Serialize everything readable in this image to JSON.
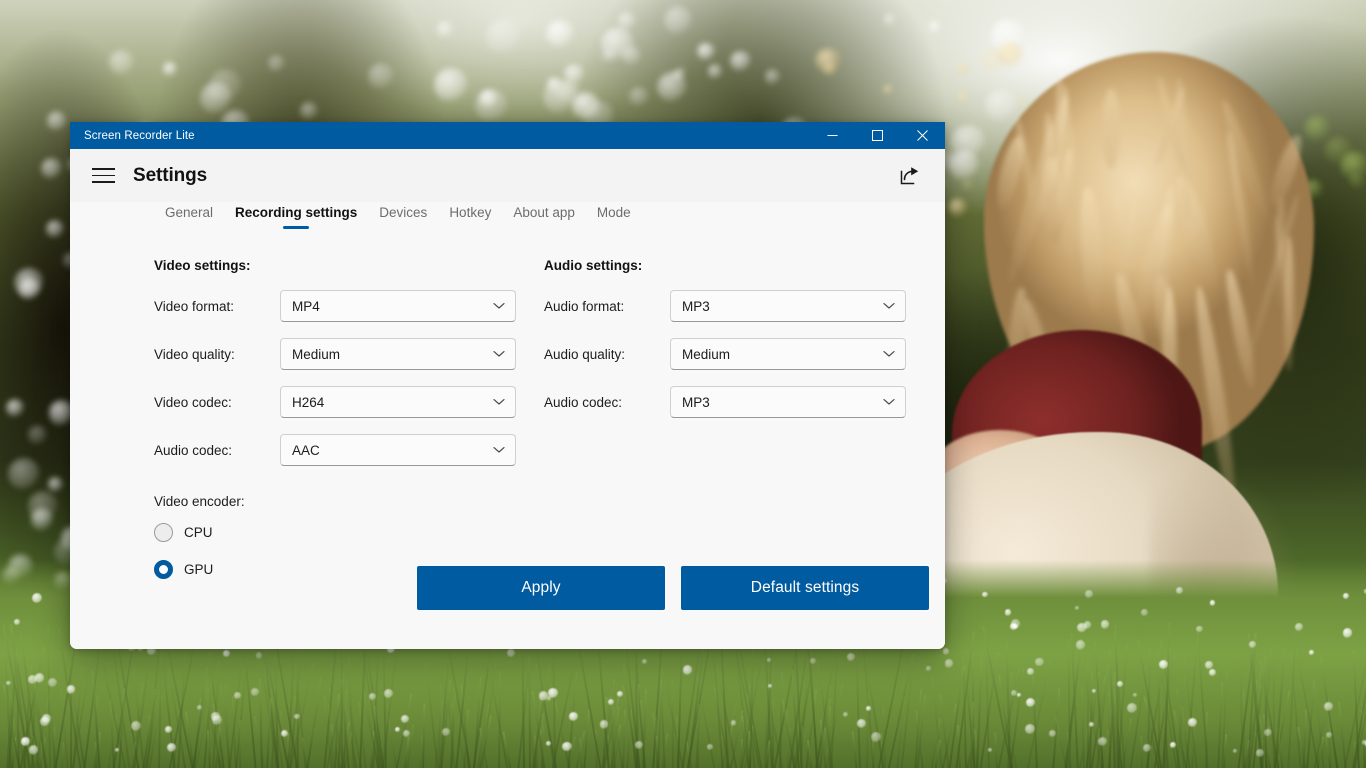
{
  "window": {
    "title": "Screen Recorder Lite",
    "controls": {
      "minimize": "minimize-button",
      "maximize": "maximize-button",
      "close": "close-button"
    }
  },
  "header": {
    "menu_icon": "hamburger-menu-icon",
    "page_title": "Settings",
    "share_icon": "share-icon"
  },
  "tabs": [
    {
      "label": "General",
      "active": false
    },
    {
      "label": "Recording settings",
      "active": true
    },
    {
      "label": "Devices",
      "active": false
    },
    {
      "label": "Hotkey",
      "active": false
    },
    {
      "label": "About app",
      "active": false
    },
    {
      "label": "Mode",
      "active": false
    }
  ],
  "video_settings": {
    "title": "Video settings:",
    "fields": [
      {
        "label": "Video format:",
        "value": "MP4"
      },
      {
        "label": "Video quality:",
        "value": "Medium"
      },
      {
        "label": "Video codec:",
        "value": "H264"
      },
      {
        "label": "Audio codec:",
        "value": "AAC"
      }
    ]
  },
  "audio_settings": {
    "title": "Audio settings:",
    "fields": [
      {
        "label": "Audio format:",
        "value": "MP3"
      },
      {
        "label": "Audio quality:",
        "value": "Medium"
      },
      {
        "label": "Audio codec:",
        "value": "MP3"
      }
    ]
  },
  "encoder": {
    "label": "Video encoder:",
    "options": [
      {
        "label": "CPU",
        "selected": false
      },
      {
        "label": "GPU",
        "selected": true
      }
    ]
  },
  "actions": {
    "apply": "Apply",
    "default_settings": "Default settings"
  },
  "colors": {
    "accent": "#005ba1",
    "titlebar": "#005ba1",
    "window_bg": "#f8f8f8",
    "header_bg": "#f3f3f3",
    "text": "#1c1c1c",
    "muted_text": "#6d6d6d"
  }
}
